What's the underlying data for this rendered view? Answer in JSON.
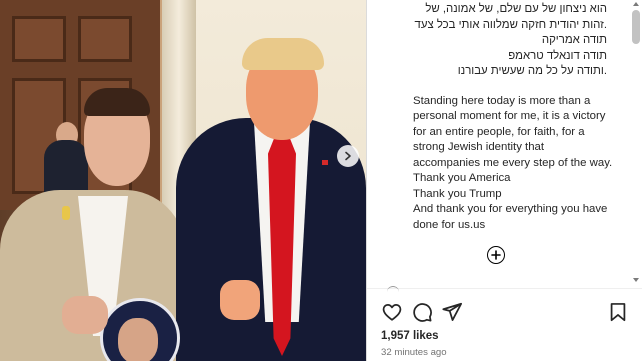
{
  "caption": {
    "hebrew_lines": [
      "הוא ניצחון של עם שלם, של אמונה, של",
      ".זהות יהודית חזקה שמלווה אותי בכל צעד",
      "תודה אמריקה",
      "תודה דונאלד טראמפ",
      ".ותודה על כל מה שעשית עבורנו"
    ],
    "english_lines": [
      "Standing here today is more than a",
      "personal moment for me, it is a victory",
      "for an entire people, for faith, for a",
      "strong Jewish identity that",
      "accompanies me every step of the way.",
      "Thank you America",
      "Thank you Trump",
      "And thank you for everything you have",
      "done for us.us"
    ]
  },
  "icons": {
    "add_comment": "plus-circle-icon",
    "like": "heart-icon",
    "comment": "comment-bubble-icon",
    "share": "paper-plane-icon",
    "save": "bookmark-icon",
    "next": "chevron-right-icon"
  },
  "stats": {
    "likes": "1,957 likes",
    "time_ago": "32 minutes ago"
  },
  "colors": {
    "text": "#262626",
    "muted": "#737373",
    "border": "#dbdbdb"
  }
}
